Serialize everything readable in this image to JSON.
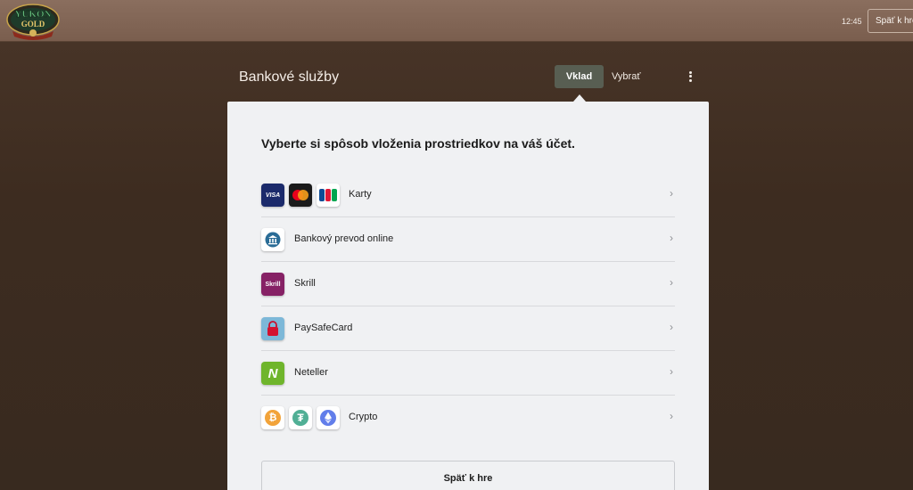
{
  "topbar": {
    "logo_text": "YUKON GOLD",
    "clock": "12:45",
    "back_label": "Späť k hre"
  },
  "header": {
    "title": "Bankové služby",
    "tabs": [
      {
        "label": "Vklad",
        "active": true
      },
      {
        "label": "Vybrať",
        "active": false
      }
    ]
  },
  "panel": {
    "heading": "Vyberte si spôsob vloženia prostriedkov na váš účet.",
    "methods": [
      {
        "label": "Karty",
        "icons": [
          "visa-icon",
          "mastercard-icon",
          "jcb-icon"
        ]
      },
      {
        "label": "Bankový prevod online",
        "icons": [
          "bank-icon"
        ]
      },
      {
        "label": "Skrill",
        "icons": [
          "skrill-icon"
        ]
      },
      {
        "label": "PaySafeCard",
        "icons": [
          "paysafecard-icon"
        ]
      },
      {
        "label": "Neteller",
        "icons": [
          "neteller-icon"
        ]
      },
      {
        "label": "Crypto",
        "icons": [
          "bitcoin-icon",
          "tether-icon",
          "ethereum-icon"
        ]
      }
    ],
    "icon_text": {
      "visa": "VISA",
      "skrill": "Skrill",
      "neteller": "N",
      "bitcoin": "₿",
      "tether": "₮"
    },
    "back_label": "Späť k hre"
  },
  "colors": {
    "accent_tab": "#585e52",
    "panel_bg": "#f0f1f3",
    "page_bg": "#3d2c20"
  }
}
